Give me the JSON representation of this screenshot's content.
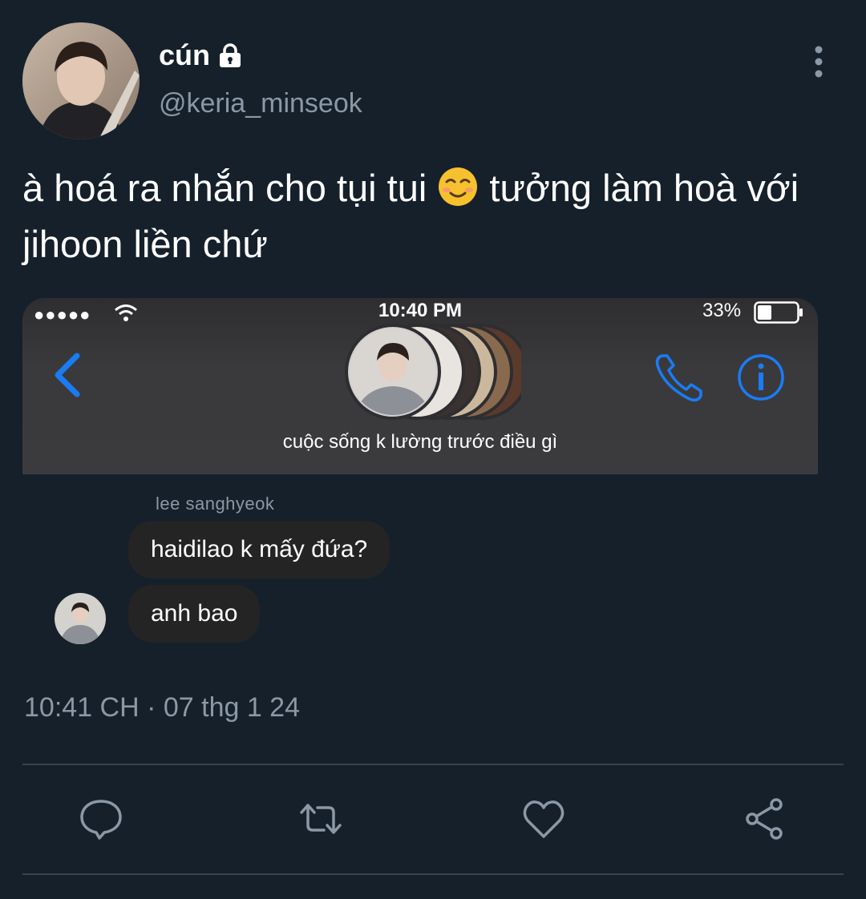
{
  "author": {
    "display_name": "cún",
    "handle": "@keria_minseok",
    "protected_icon": "lock-icon"
  },
  "tweet": {
    "text_before_emoji": "à hoá ra nhắn cho tụi tui ",
    "emoji": "smiling-face-emoji",
    "text_after_emoji": " tưởng làm hoà với jihoon liền chứ",
    "timestamp": "10:41 CH · 07 thg 1 24"
  },
  "screenshot": {
    "status_bar": {
      "signal": "●●●●●",
      "time": "10:40 PM",
      "battery": "33%"
    },
    "group_name": "cuộc sống k lường trước điều gì",
    "sender_name": "lee sanghyeok",
    "messages": [
      {
        "text": "haidilao k mấy đứa?"
      },
      {
        "text": "anh bao"
      }
    ]
  },
  "actions": [
    "reply-icon",
    "retweet-icon",
    "like-icon",
    "share-icon"
  ],
  "colors": {
    "background": "#15202b",
    "secondary_text": "#8b98a5",
    "ios_blue": "#1a7cf5",
    "bubble": "#242424"
  }
}
